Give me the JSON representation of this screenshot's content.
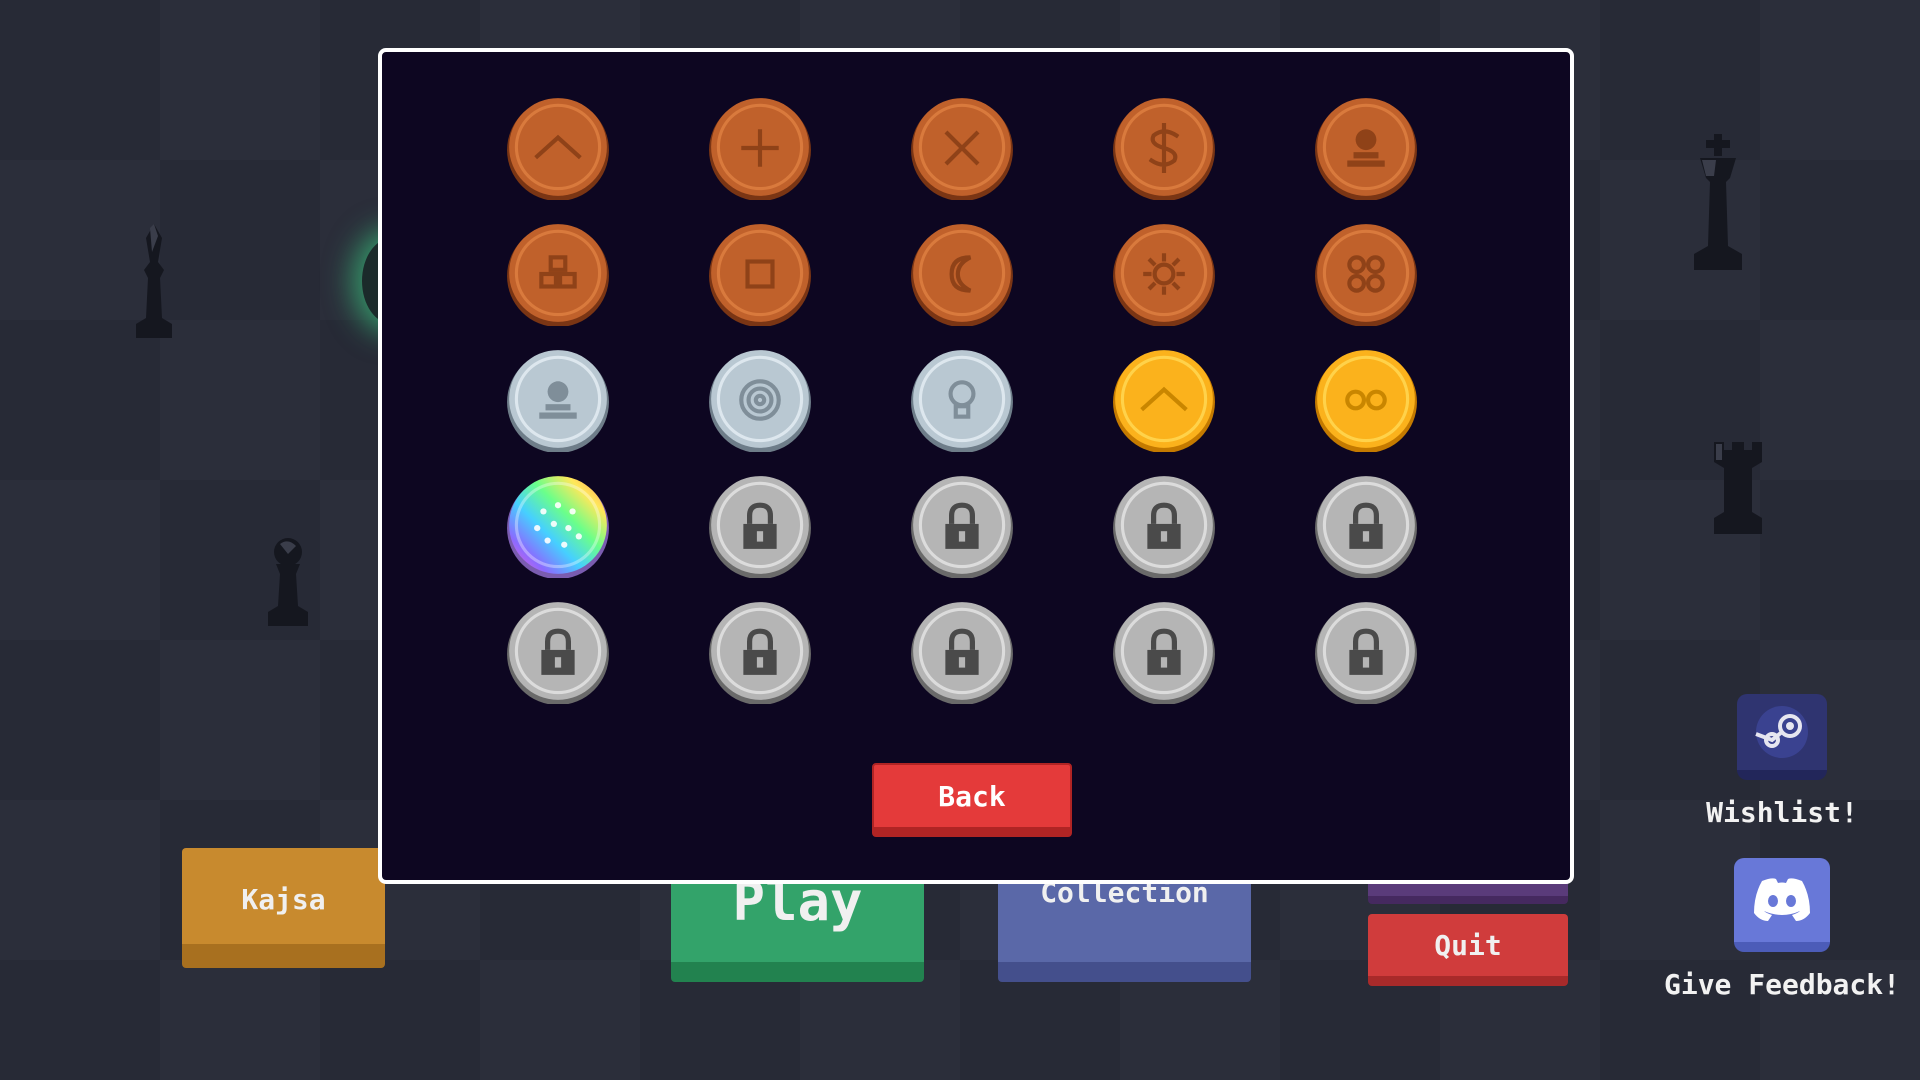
{
  "menu": {
    "player_button_label": "Kajsa",
    "play_button_label": "Play",
    "collection_button_label": "Collection",
    "quit_button_label": "Quit"
  },
  "social": {
    "wishlist_label": "Wishlist!",
    "wishlist_icon": "steam-icon",
    "feedback_label": "Give Feedback!",
    "feedback_icon": "discord-icon"
  },
  "modal": {
    "back_label": "Back",
    "coins": [
      {
        "material": "bronze",
        "symbol": "chevron-up"
      },
      {
        "material": "bronze",
        "symbol": "plus"
      },
      {
        "material": "bronze",
        "symbol": "cross"
      },
      {
        "material": "bronze",
        "symbol": "dollar"
      },
      {
        "material": "bronze",
        "symbol": "pawn-bust"
      },
      {
        "material": "bronze",
        "symbol": "blocks"
      },
      {
        "material": "bronze",
        "symbol": "square"
      },
      {
        "material": "bronze",
        "symbol": "moon"
      },
      {
        "material": "bronze",
        "symbol": "flower"
      },
      {
        "material": "bronze",
        "symbol": "four-circles"
      },
      {
        "material": "silver",
        "symbol": "pawn-bust"
      },
      {
        "material": "silver",
        "symbol": "target"
      },
      {
        "material": "silver",
        "symbol": "bulb"
      },
      {
        "material": "gold",
        "symbol": "chevron-up"
      },
      {
        "material": "gold",
        "symbol": "double-circle"
      },
      {
        "material": "rainbow",
        "symbol": "dots"
      },
      {
        "material": "locked",
        "symbol": "lock"
      },
      {
        "material": "locked",
        "symbol": "lock"
      },
      {
        "material": "locked",
        "symbol": "lock"
      },
      {
        "material": "locked",
        "symbol": "lock"
      },
      {
        "material": "locked",
        "symbol": "lock"
      },
      {
        "material": "locked",
        "symbol": "lock"
      },
      {
        "material": "locked",
        "symbol": "lock"
      },
      {
        "material": "locked",
        "symbol": "lock"
      },
      {
        "material": "locked",
        "symbol": "lock"
      }
    ]
  },
  "colors": {
    "background": "#272a36",
    "modal_bg": "#0d0621",
    "bronze": "#c0612b",
    "silver": "#b9c8d2",
    "gold": "#fbb21c",
    "locked": "#b5b5b5",
    "back_button": "#e43a3a"
  }
}
